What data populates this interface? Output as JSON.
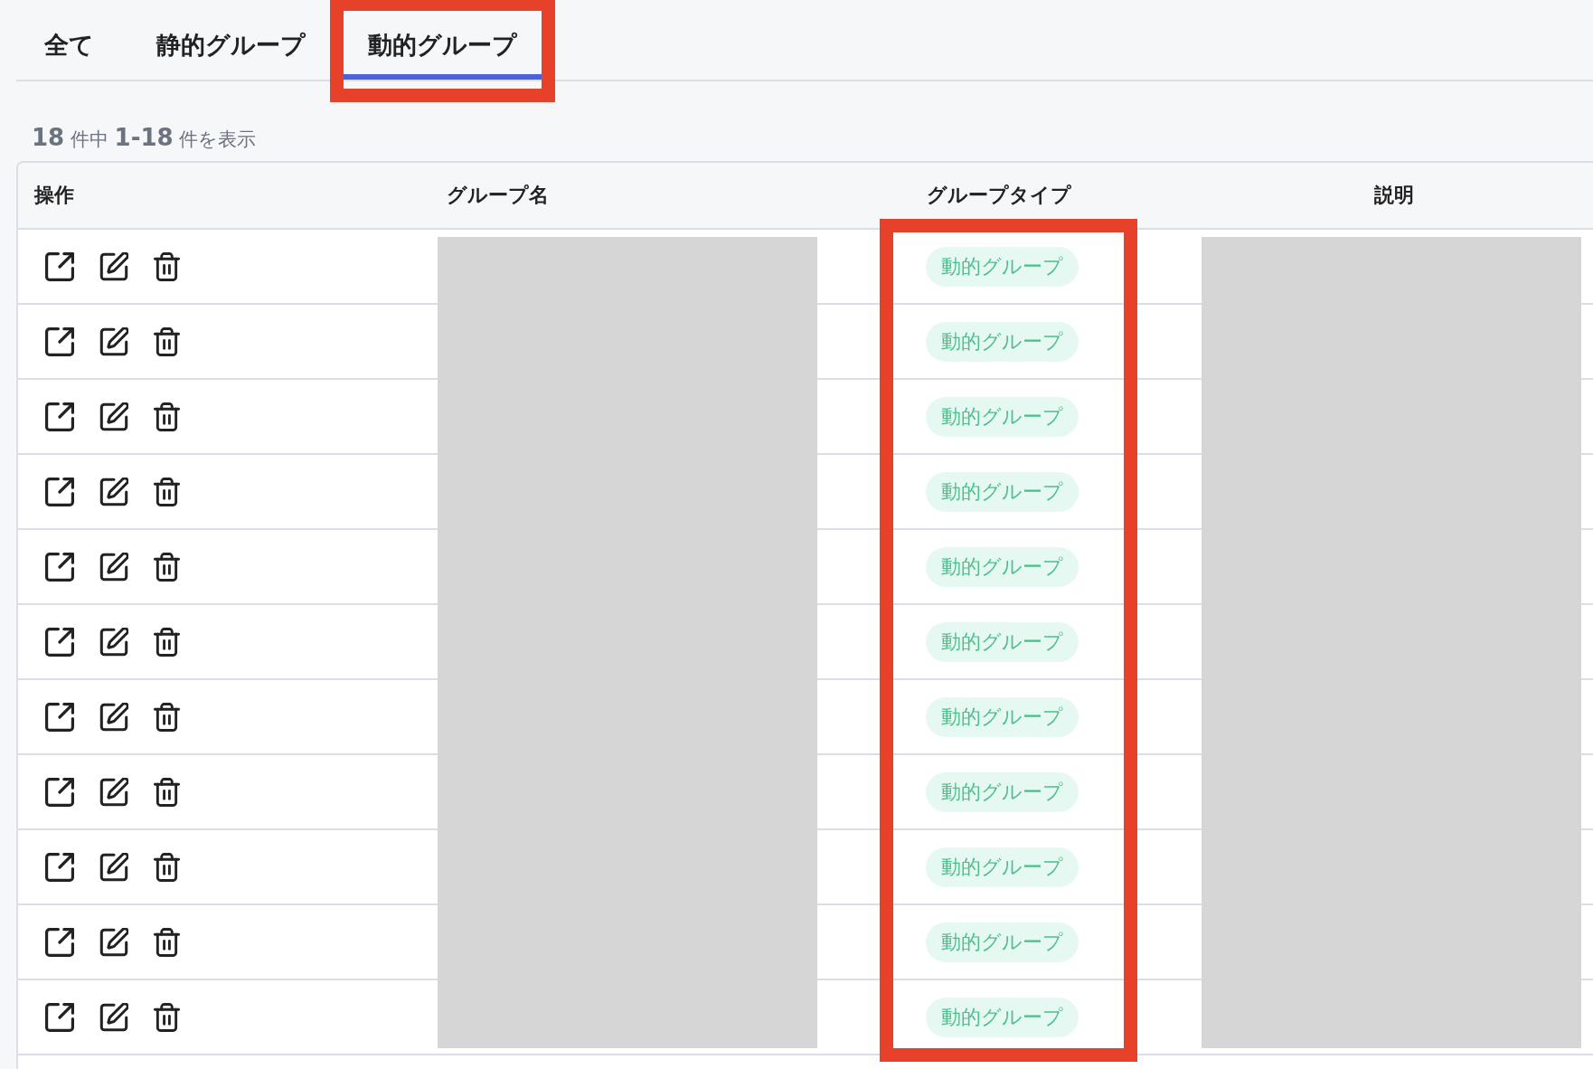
{
  "tabs": [
    {
      "label": "全て",
      "selected": false,
      "highlighted": false
    },
    {
      "label": "静的グループ",
      "selected": false,
      "highlighted": false
    },
    {
      "label": "動的グループ",
      "selected": true,
      "highlighted": true
    }
  ],
  "summary": "**18** 件中 **1-18** 件を表示",
  "table": {
    "columns": [
      {
        "label": "操作",
        "kind": "actions",
        "redacted": false,
        "highlighted": false
      },
      {
        "label": "グループ名",
        "kind": "text",
        "redacted": true,
        "highlighted": false
      },
      {
        "label": "グループタイプ",
        "kind": "tag",
        "redacted": false,
        "highlighted": true
      },
      {
        "label": "説明",
        "kind": "text",
        "redacted": true,
        "highlighted": false
      }
    ],
    "rows": [
      {
        "group_type": "動的グループ"
      },
      {
        "group_type": "動的グループ"
      },
      {
        "group_type": "動的グループ"
      },
      {
        "group_type": "動的グループ"
      },
      {
        "group_type": "動的グループ"
      },
      {
        "group_type": "動的グループ"
      },
      {
        "group_type": "動的グループ"
      },
      {
        "group_type": "動的グループ"
      },
      {
        "group_type": "動的グループ"
      },
      {
        "group_type": "動的グループ"
      },
      {
        "group_type": "動的グループ"
      }
    ]
  }
}
